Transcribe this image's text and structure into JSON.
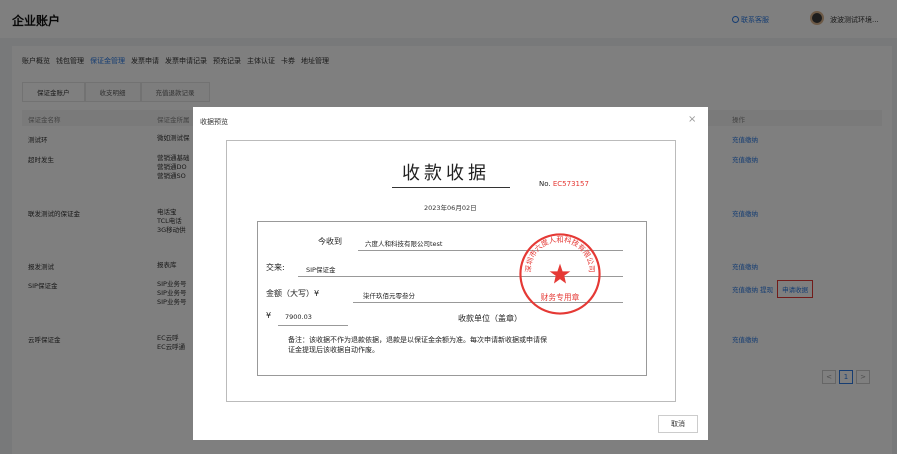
{
  "header": {
    "title": "企业账户",
    "help": "联系客服",
    "user": "波波测试环境..."
  },
  "tabs": [
    "账户概览",
    "钱包管理",
    "保证金管理",
    "发票申请",
    "发票申请记录",
    "预充记录",
    "主体认证",
    "卡券",
    "地址管理"
  ],
  "active_tab": 2,
  "subtabs": [
    "保证金账户",
    "收支明细",
    "充值退款记录"
  ],
  "table": {
    "headers": [
      "保证金名称",
      "保证金所属",
      "操作"
    ],
    "rows": [
      {
        "name": "测试环",
        "sub": [
          "微如测试保"
        ],
        "ops": "充值缴纳"
      },
      {
        "name": "超时发生",
        "sub": [
          "营销通基础",
          "营销通DO",
          "营销通SO"
        ],
        "ops": "充值缴纳"
      },
      {
        "name": "联发测试的保证金",
        "sub": [
          "电话宝",
          "TCL电话",
          "3G移动供"
        ],
        "ops": "充值缴纳"
      },
      {
        "name": "报发测试",
        "sub": [
          "报表库"
        ],
        "ops": "充值缴纳"
      },
      {
        "name": "SIP保证金",
        "sub": [
          "SIP业务号",
          "SIP业务号",
          "SIP业务号"
        ],
        "ops": "充值缴纳",
        "extra": [
          "提现",
          "申请收据"
        ]
      },
      {
        "name": "云呼保证金",
        "sub": [
          "EC云呼",
          "EC云呼通"
        ],
        "ops": "充值缴纳"
      }
    ]
  },
  "pager": {
    "prev": "<",
    "current": "1",
    "next": ">"
  },
  "modal": {
    "title": "收据预览",
    "close": "×",
    "cancel": "取消",
    "receipt": {
      "title": "收款收据",
      "no_label": "No.",
      "no_value": "EC573157",
      "date": "2023年06月02日",
      "payer_label": "今收到",
      "payer": "六度人和科技有限公司test",
      "item_label": "交来:",
      "item": "SIP保证金",
      "amount_cn_label": "金额（大写）¥",
      "amount_cn": "柒仟玖佰元零叁分",
      "currency": "¥",
      "amount": "7900.03",
      "stamp_label": "收款单位（盖章）",
      "memo": "备注：该收据不作为退款依据，退款是以保证金余额为准。每次申请新收据或申请保证金提现后该收据自动作废。",
      "seal_company": "深圳市六度人和科技有限公司",
      "seal_center": "财务专用章"
    }
  }
}
